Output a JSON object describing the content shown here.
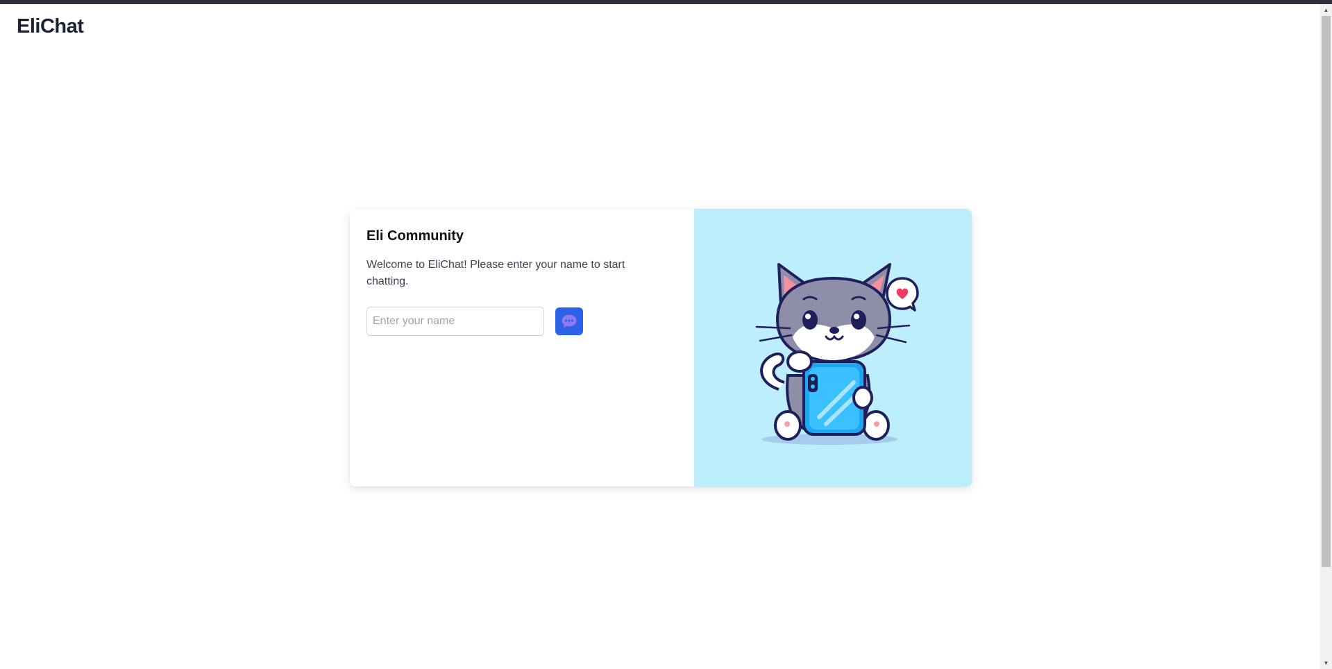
{
  "app": {
    "brand": "EliChat"
  },
  "card": {
    "title": "Eli Community",
    "description": "Welcome to EliChat! Please enter your name to start chatting.",
    "name_input": {
      "placeholder": "Enter your name",
      "value": ""
    },
    "send_button": {
      "icon": "chat-bubble-icon"
    },
    "illustration": {
      "subject": "cat-with-phone-illustration",
      "background": "#bdeefc"
    }
  },
  "colors": {
    "accent": "#2b63e8",
    "brand_text": "#1c2233",
    "topbar": "#2f2f3d"
  }
}
